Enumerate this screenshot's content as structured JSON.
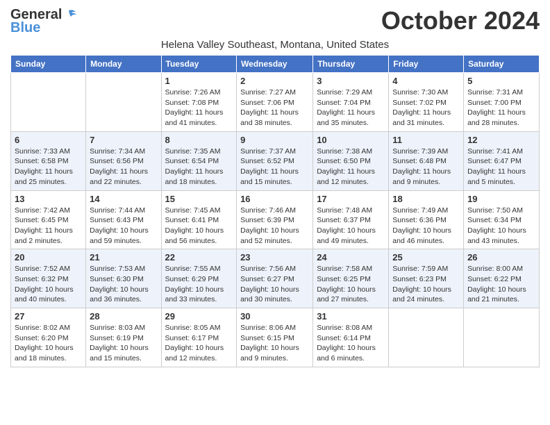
{
  "logo": {
    "line1": "General",
    "line2": "Blue"
  },
  "title": "October 2024",
  "location": "Helena Valley Southeast, Montana, United States",
  "weekdays": [
    "Sunday",
    "Monday",
    "Tuesday",
    "Wednesday",
    "Thursday",
    "Friday",
    "Saturday"
  ],
  "weeks": [
    [
      {
        "day": "",
        "info": ""
      },
      {
        "day": "",
        "info": ""
      },
      {
        "day": "1",
        "info": "Sunrise: 7:26 AM\nSunset: 7:08 PM\nDaylight: 11 hours and 41 minutes."
      },
      {
        "day": "2",
        "info": "Sunrise: 7:27 AM\nSunset: 7:06 PM\nDaylight: 11 hours and 38 minutes."
      },
      {
        "day": "3",
        "info": "Sunrise: 7:29 AM\nSunset: 7:04 PM\nDaylight: 11 hours and 35 minutes."
      },
      {
        "day": "4",
        "info": "Sunrise: 7:30 AM\nSunset: 7:02 PM\nDaylight: 11 hours and 31 minutes."
      },
      {
        "day": "5",
        "info": "Sunrise: 7:31 AM\nSunset: 7:00 PM\nDaylight: 11 hours and 28 minutes."
      }
    ],
    [
      {
        "day": "6",
        "info": "Sunrise: 7:33 AM\nSunset: 6:58 PM\nDaylight: 11 hours and 25 minutes."
      },
      {
        "day": "7",
        "info": "Sunrise: 7:34 AM\nSunset: 6:56 PM\nDaylight: 11 hours and 22 minutes."
      },
      {
        "day": "8",
        "info": "Sunrise: 7:35 AM\nSunset: 6:54 PM\nDaylight: 11 hours and 18 minutes."
      },
      {
        "day": "9",
        "info": "Sunrise: 7:37 AM\nSunset: 6:52 PM\nDaylight: 11 hours and 15 minutes."
      },
      {
        "day": "10",
        "info": "Sunrise: 7:38 AM\nSunset: 6:50 PM\nDaylight: 11 hours and 12 minutes."
      },
      {
        "day": "11",
        "info": "Sunrise: 7:39 AM\nSunset: 6:48 PM\nDaylight: 11 hours and 9 minutes."
      },
      {
        "day": "12",
        "info": "Sunrise: 7:41 AM\nSunset: 6:47 PM\nDaylight: 11 hours and 5 minutes."
      }
    ],
    [
      {
        "day": "13",
        "info": "Sunrise: 7:42 AM\nSunset: 6:45 PM\nDaylight: 11 hours and 2 minutes."
      },
      {
        "day": "14",
        "info": "Sunrise: 7:44 AM\nSunset: 6:43 PM\nDaylight: 10 hours and 59 minutes."
      },
      {
        "day": "15",
        "info": "Sunrise: 7:45 AM\nSunset: 6:41 PM\nDaylight: 10 hours and 56 minutes."
      },
      {
        "day": "16",
        "info": "Sunrise: 7:46 AM\nSunset: 6:39 PM\nDaylight: 10 hours and 52 minutes."
      },
      {
        "day": "17",
        "info": "Sunrise: 7:48 AM\nSunset: 6:37 PM\nDaylight: 10 hours and 49 minutes."
      },
      {
        "day": "18",
        "info": "Sunrise: 7:49 AM\nSunset: 6:36 PM\nDaylight: 10 hours and 46 minutes."
      },
      {
        "day": "19",
        "info": "Sunrise: 7:50 AM\nSunset: 6:34 PM\nDaylight: 10 hours and 43 minutes."
      }
    ],
    [
      {
        "day": "20",
        "info": "Sunrise: 7:52 AM\nSunset: 6:32 PM\nDaylight: 10 hours and 40 minutes."
      },
      {
        "day": "21",
        "info": "Sunrise: 7:53 AM\nSunset: 6:30 PM\nDaylight: 10 hours and 36 minutes."
      },
      {
        "day": "22",
        "info": "Sunrise: 7:55 AM\nSunset: 6:29 PM\nDaylight: 10 hours and 33 minutes."
      },
      {
        "day": "23",
        "info": "Sunrise: 7:56 AM\nSunset: 6:27 PM\nDaylight: 10 hours and 30 minutes."
      },
      {
        "day": "24",
        "info": "Sunrise: 7:58 AM\nSunset: 6:25 PM\nDaylight: 10 hours and 27 minutes."
      },
      {
        "day": "25",
        "info": "Sunrise: 7:59 AM\nSunset: 6:23 PM\nDaylight: 10 hours and 24 minutes."
      },
      {
        "day": "26",
        "info": "Sunrise: 8:00 AM\nSunset: 6:22 PM\nDaylight: 10 hours and 21 minutes."
      }
    ],
    [
      {
        "day": "27",
        "info": "Sunrise: 8:02 AM\nSunset: 6:20 PM\nDaylight: 10 hours and 18 minutes."
      },
      {
        "day": "28",
        "info": "Sunrise: 8:03 AM\nSunset: 6:19 PM\nDaylight: 10 hours and 15 minutes."
      },
      {
        "day": "29",
        "info": "Sunrise: 8:05 AM\nSunset: 6:17 PM\nDaylight: 10 hours and 12 minutes."
      },
      {
        "day": "30",
        "info": "Sunrise: 8:06 AM\nSunset: 6:15 PM\nDaylight: 10 hours and 9 minutes."
      },
      {
        "day": "31",
        "info": "Sunrise: 8:08 AM\nSunset: 6:14 PM\nDaylight: 10 hours and 6 minutes."
      },
      {
        "day": "",
        "info": ""
      },
      {
        "day": "",
        "info": ""
      }
    ]
  ]
}
